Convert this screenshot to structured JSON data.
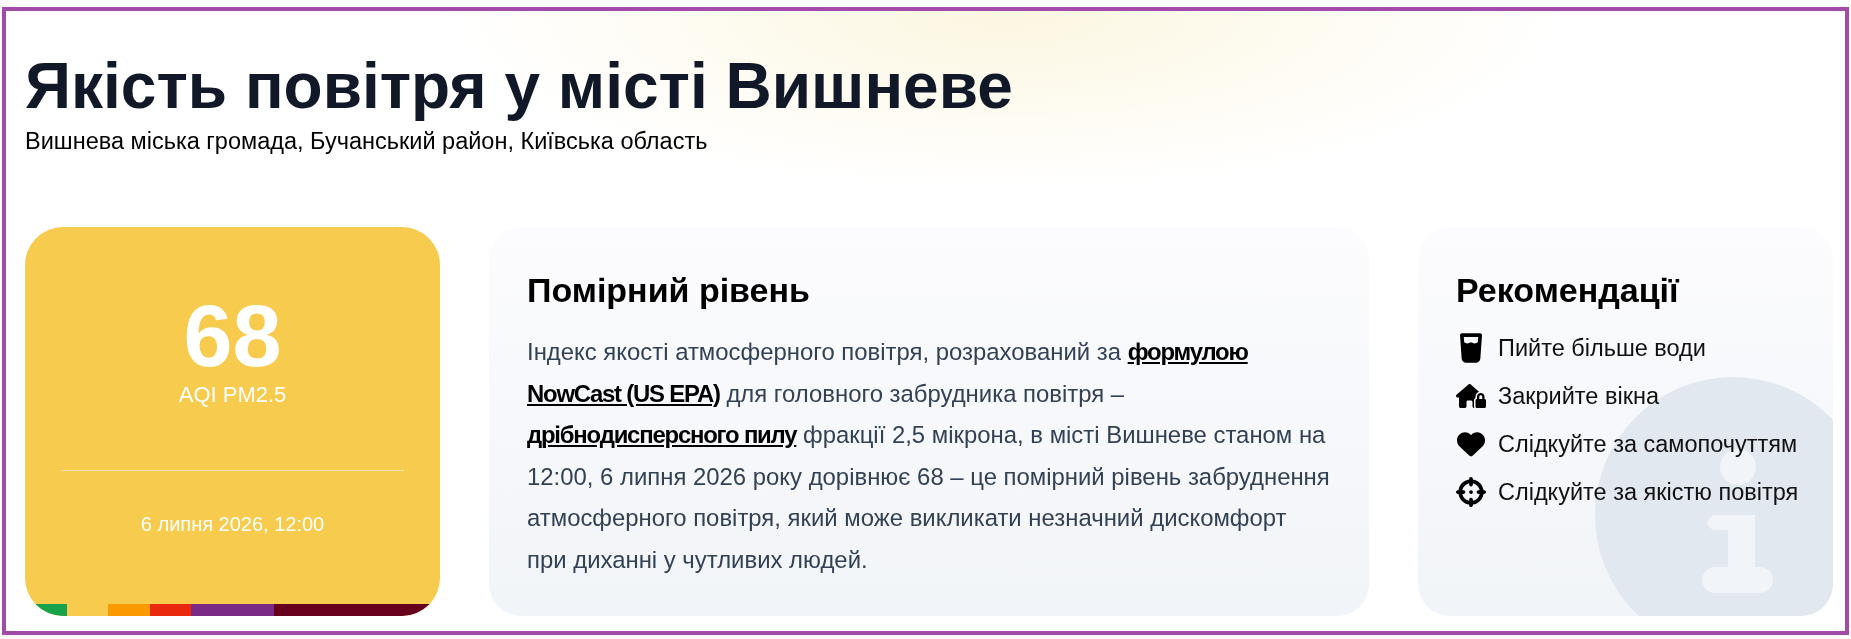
{
  "header": {
    "title": "Якість повітря у місті Вишневе",
    "subtitle": "Вишнева міська громада, Бучанський район, Київська область"
  },
  "aqi_card": {
    "value": "68",
    "label": "AQI PM2.5",
    "time": "6 липня 2026, 12:00",
    "scale": [
      {
        "color": "#17a34a"
      },
      {
        "color": "#f7cb4d"
      },
      {
        "color": "#fb9a00"
      },
      {
        "color": "#e8290e"
      },
      {
        "color": "#7b2a84"
      },
      {
        "color": "#67001f"
      }
    ]
  },
  "description": {
    "title": "Помірний рівень",
    "paragraph": [
      {
        "kind": "text",
        "text": "Індекс якості атмосферного повітря, розрахований за"
      },
      {
        "kind": "link",
        "parts": [
          "формулою",
          "NowCast (US EPA)"
        ]
      },
      {
        "kind": "text",
        "text": "для головного забрудника повітря –"
      },
      {
        "kind": "link",
        "parts": [
          "дрібнодисперсного пилу"
        ]
      },
      {
        "kind": "text",
        "text": "фракції 2,5 мікрона, в місті Вишневе станом на 12:00, 6 липня 2026 року дорівнює 68 – це помірний рівень забруднення атмосферного повітря, який може викликати незначний дискомфорт при диханні у чутливих людей."
      }
    ]
  },
  "recommendations": {
    "title": "Рекомендації",
    "items": [
      "Пийте більше води",
      "Закрийте вікна",
      "Слідкуйте за самопочуттям",
      "Слідкуйте за якістю повітря"
    ]
  }
}
